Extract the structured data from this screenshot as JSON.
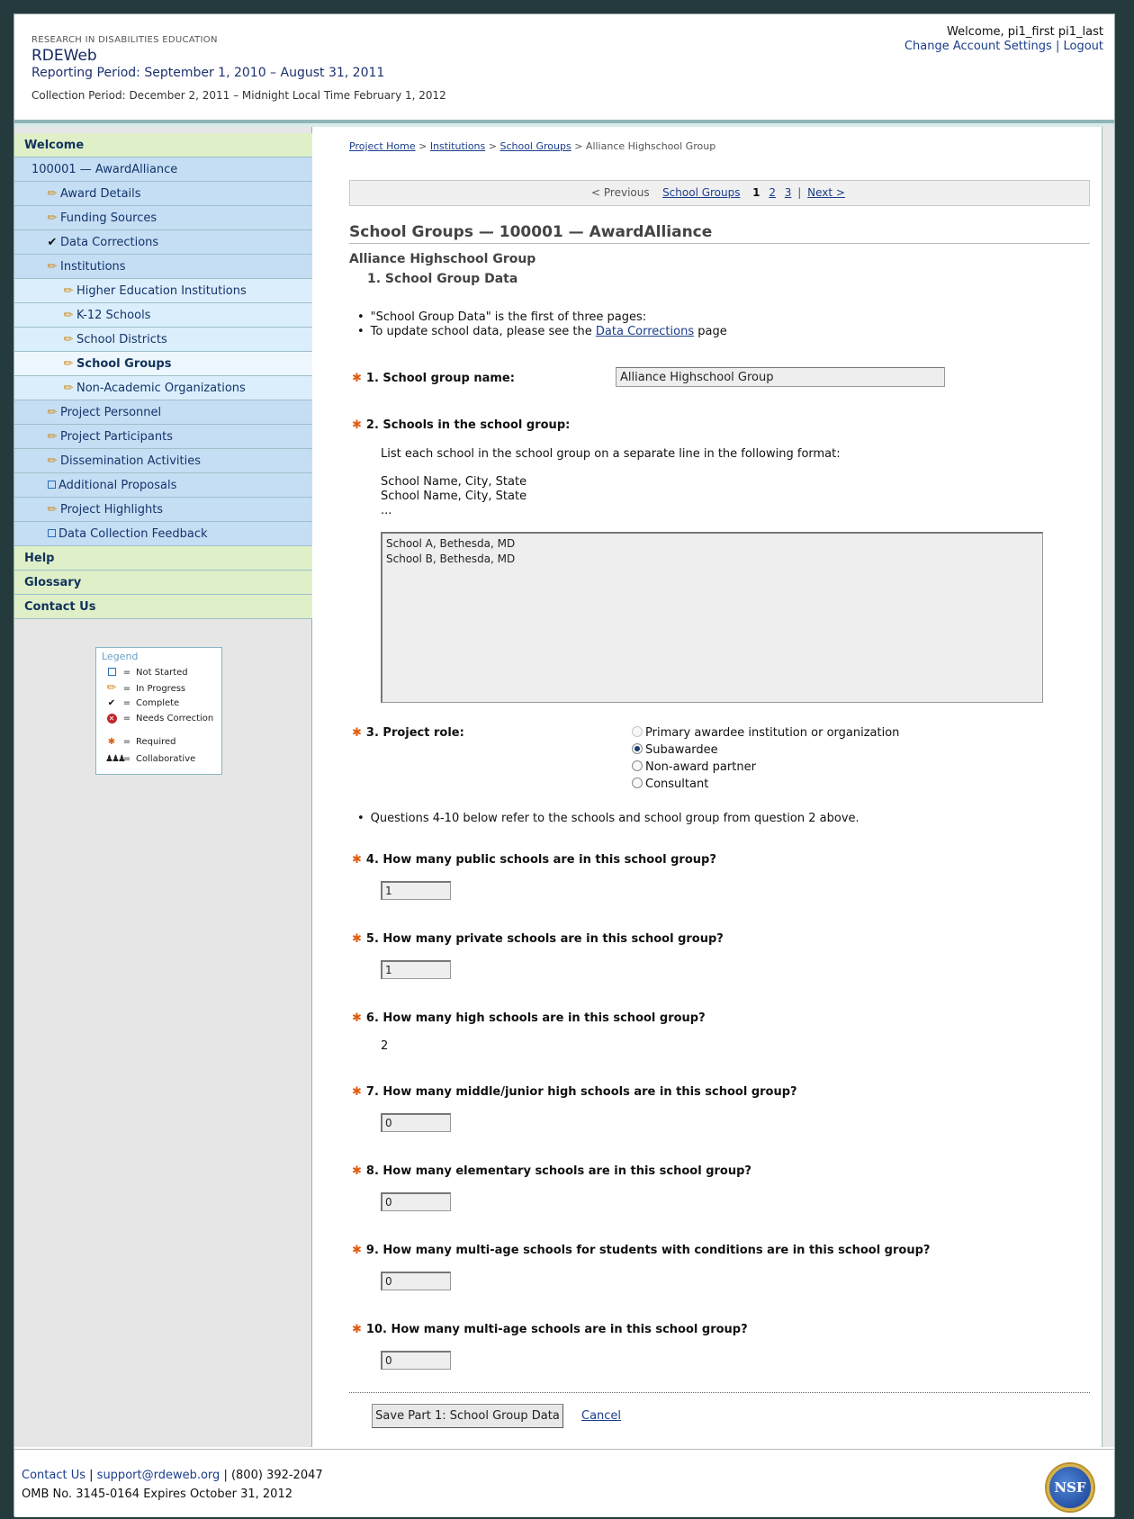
{
  "header": {
    "org": "RESEARCH IN DISABILITIES EDUCATION",
    "app_name": "RDEWeb",
    "reporting_period": "Reporting Period: September 1, 2010 – August 31, 2011",
    "collection_period": "Collection Period: December 2, 2011 – Midnight Local Time February 1, 2012",
    "welcome": "Welcome, pi1_first pi1_last",
    "change_settings": "Change Account Settings",
    "separator": "|",
    "logout": "Logout"
  },
  "sidebar": {
    "welcome": "Welcome",
    "award": "100001 — AwardAlliance",
    "items": [
      {
        "label": "Award Details",
        "status": "pencil-icon"
      },
      {
        "label": "Funding Sources",
        "status": "pencil-icon"
      },
      {
        "label": "Data Corrections",
        "status": "check-icon"
      },
      {
        "label": "Institutions",
        "status": "pencil-icon"
      },
      {
        "label": "Higher Education Institutions",
        "status": "pencil-icon"
      },
      {
        "label": "K-12 Schools",
        "status": "pencil-icon"
      },
      {
        "label": "School Districts",
        "status": "pencil-icon"
      },
      {
        "label": "School Groups",
        "status": "pencil-icon"
      },
      {
        "label": "Non-Academic Organizations",
        "status": "pencil-icon"
      },
      {
        "label": "Project Personnel",
        "status": "pencil-icon"
      },
      {
        "label": "Project Participants",
        "status": "pencil-icon"
      },
      {
        "label": "Dissemination Activities",
        "status": "pencil-icon"
      },
      {
        "label": "Additional Proposals",
        "status": "box-icon"
      },
      {
        "label": "Project Highlights",
        "status": "pencil-icon"
      },
      {
        "label": "Data Collection Feedback",
        "status": "box-icon"
      }
    ],
    "help": "Help",
    "glossary": "Glossary",
    "contact": "Contact Us"
  },
  "legend": {
    "title": "Legend",
    "eq": "=",
    "not_started": "Not Started",
    "in_progress": "In Progress",
    "complete": "Complete",
    "needs_correction": "Needs Correction",
    "required": "Required",
    "collaborative": "Collaborative"
  },
  "breadcrumb": {
    "home": "Project Home",
    "institutions": "Institutions",
    "school_groups": "School Groups",
    "current": "Alliance Highschool Group",
    "sep": ">"
  },
  "pager": {
    "previous": "< Previous",
    "section": "School Groups",
    "p1": "1",
    "p2": "2",
    "p3": "3",
    "bar": "|",
    "next": "Next >"
  },
  "main": {
    "title": "School Groups — 100001 — AwardAlliance",
    "group_name": "Alliance Highschool Group",
    "section": "1. School Group Data",
    "bullet1": "\"School Group Data\" is the first of three pages:",
    "bullet2_pre": "To update school data, please see the",
    "bullet2_link": "Data Corrections",
    "bullet2_post": "page",
    "q1": "1. School group name:",
    "q1_value": "Alliance Highschool Group",
    "q2": "2. Schools in the school group:",
    "q2_help": "List each school in the school group on a separate line in the following format:",
    "q2_fmt1": "School Name, City, State",
    "q2_fmt2": "School Name, City, State",
    "q2_fmt3": "...",
    "q2_line1": "School A, Bethesda, MD",
    "q2_line2": "School B, Bethesda, MD",
    "q3": "3. Project role:",
    "q3_options": [
      "Primary awardee institution or organization",
      "Subawardee",
      "Non-award partner",
      "Consultant"
    ],
    "q3_selected": "Subawardee",
    "note": "Questions 4-10 below refer to the schools and school group from question 2 above.",
    "q4": "4. How many public schools are in this school group?",
    "q4_value": "1",
    "q5": "5. How many private schools are in this school group?",
    "q5_value": "1",
    "q6": "6. How many high schools are in this school group?",
    "q6_value": "2",
    "q7": "7. How many middle/junior high schools are in this school group?",
    "q7_value": "0",
    "q8": "8. How many elementary schools are in this school group?",
    "q8_value": "0",
    "q9": "9. How many multi-age schools for students with conditions are in this school group?",
    "q9_value": "0",
    "q10": "10. How many multi-age schools are in this school group?",
    "q10_value": "0",
    "save": "Save Part 1: School Group Data",
    "cancel": "Cancel"
  },
  "footer": {
    "contact": "Contact Us",
    "sep": "|",
    "email": "support@rdeweb.org",
    "phone": "(800) 392-2047",
    "omb": "OMB No. 3145-0164 Expires October 31, 2012",
    "logo_text": "NSF"
  },
  "colors": {
    "background": "#253a3c",
    "nav_top": "#dff0c8",
    "nav_item": "#c5def4",
    "link": "#1a3d8a",
    "required_star": "#e05d10"
  }
}
